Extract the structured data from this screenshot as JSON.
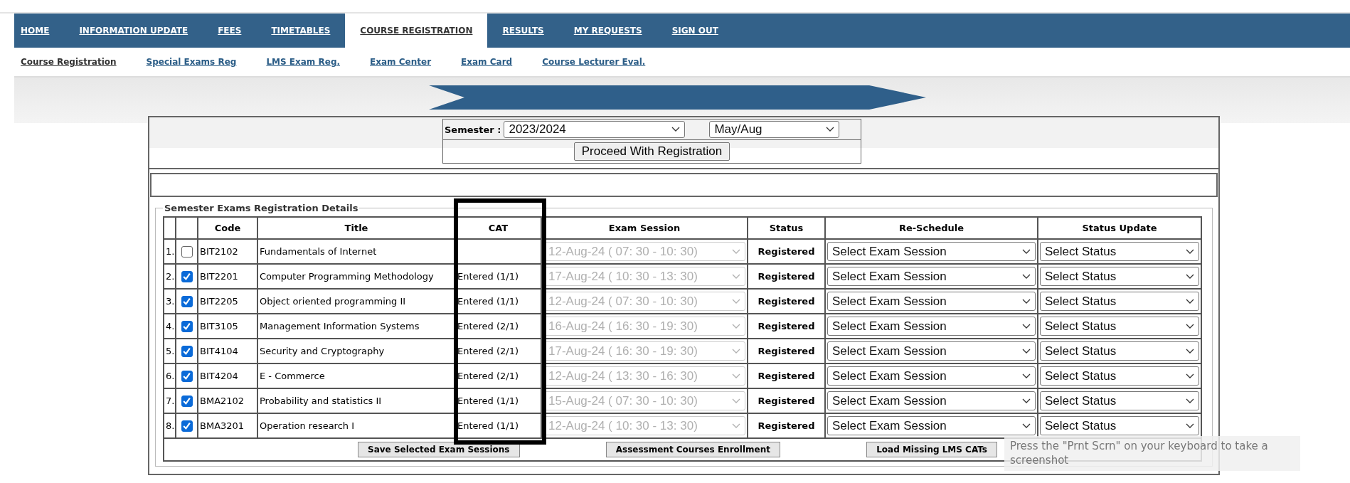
{
  "nav": [
    {
      "label": "HOME",
      "selected": false
    },
    {
      "label": "INFORMATION UPDATE",
      "selected": false
    },
    {
      "label": "FEES",
      "selected": false
    },
    {
      "label": "TIMETABLES",
      "selected": false
    },
    {
      "label": "COURSE REGISTRATION",
      "selected": true
    },
    {
      "label": "RESULTS",
      "selected": false
    },
    {
      "label": "MY REQUESTS",
      "selected": false
    },
    {
      "label": "SIGN OUT",
      "selected": false
    }
  ],
  "subnav": [
    {
      "label": "Course Registration",
      "selected": true
    },
    {
      "label": "Special Exams Reg",
      "selected": false
    },
    {
      "label": "LMS Exam Reg.",
      "selected": false
    },
    {
      "label": "Exam Center",
      "selected": false
    },
    {
      "label": "Exam Card",
      "selected": false
    },
    {
      "label": "Course Lecturer Eval.",
      "selected": false
    }
  ],
  "semester": {
    "label": "Semester :",
    "year": "2023/2024",
    "term": "May/Aug"
  },
  "proceed_button": "Proceed With Registration",
  "legend": "Semester Exams Registration Details",
  "columns": [
    "Code",
    "Title",
    "CAT",
    "Exam Session",
    "Status",
    "Re-Schedule",
    "Status Update"
  ],
  "rows": [
    {
      "number": "1.",
      "checked": false,
      "code": "BIT2102",
      "title": "Fundamentals of Internet",
      "session": "12-Aug-24 ( 07: 30 - 10: 30)",
      "disabled": true,
      "status": "Registered",
      "reschedule": "Select Exam Session",
      "status_update": "Select Status"
    },
    {
      "number": "2.",
      "checked": true,
      "code": "BIT2201",
      "title": "Computer Programming Methodology",
      "cat": "Entered (1/1)",
      "session": "17-Aug-24 ( 10: 30 - 13: 30)",
      "disabled": true,
      "status": "Registered",
      "reschedule": "Select Exam Session",
      "status_update": "Select Status"
    },
    {
      "number": "3.",
      "checked": true,
      "code": "BIT2205",
      "title": "Object oriented programming II",
      "cat": "Entered (1/1)",
      "session": "12-Aug-24 ( 07: 30 - 10: 30)",
      "disabled": true,
      "status": "Registered",
      "reschedule": "Select Exam Session",
      "status_update": "Select Status"
    },
    {
      "number": "4.",
      "checked": true,
      "code": "BIT3105",
      "title": "Management Information Systems",
      "cat": "Entered (2/1)",
      "session": "16-Aug-24 ( 16: 30 - 19: 30)",
      "disabled": true,
      "status": "Registered",
      "reschedule": "Select Exam Session",
      "status_update": "Select Status"
    },
    {
      "number": "5.",
      "checked": true,
      "code": "BIT4104",
      "title": "Security and Cryptography",
      "cat": "Entered (2/1)",
      "session": "17-Aug-24 ( 16: 30 - 19: 30)",
      "disabled": true,
      "status": "Registered",
      "reschedule": "Select Exam Session",
      "status_update": "Select Status"
    },
    {
      "number": "6.",
      "checked": true,
      "code": "BIT4204",
      "title": "E - Commerce",
      "cat": "Entered (2/1)",
      "session": "12-Aug-24 ( 13: 30 - 16: 30)",
      "disabled": true,
      "status": "Registered",
      "reschedule": "Select Exam Session",
      "status_update": "Select Status"
    },
    {
      "number": "7.",
      "checked": true,
      "code": "BMA2102",
      "title": "Probability and statistics II",
      "cat": "Entered (1/1)",
      "session": "15-Aug-24 ( 07: 30 - 10: 30)",
      "disabled": true,
      "status": "Registered",
      "reschedule": "Select Exam Session",
      "status_update": "Select Status"
    },
    {
      "number": "8.",
      "checked": true,
      "code": "BMA3201",
      "title": "Operation research I",
      "cat": "Entered (1/1)",
      "session": "12-Aug-24 ( 10: 30 - 13: 30)",
      "disabled": true,
      "status": "Registered",
      "reschedule": "Select Exam Session",
      "status_update": "Select Status"
    }
  ],
  "buttons": [
    "Save Selected Exam Sessions",
    "Assessment Courses Enrollment",
    "Load Missing LMS CATs"
  ],
  "tooltip": "Press the \"Prnt Scrn\" on your keyboard to take a screenshot"
}
